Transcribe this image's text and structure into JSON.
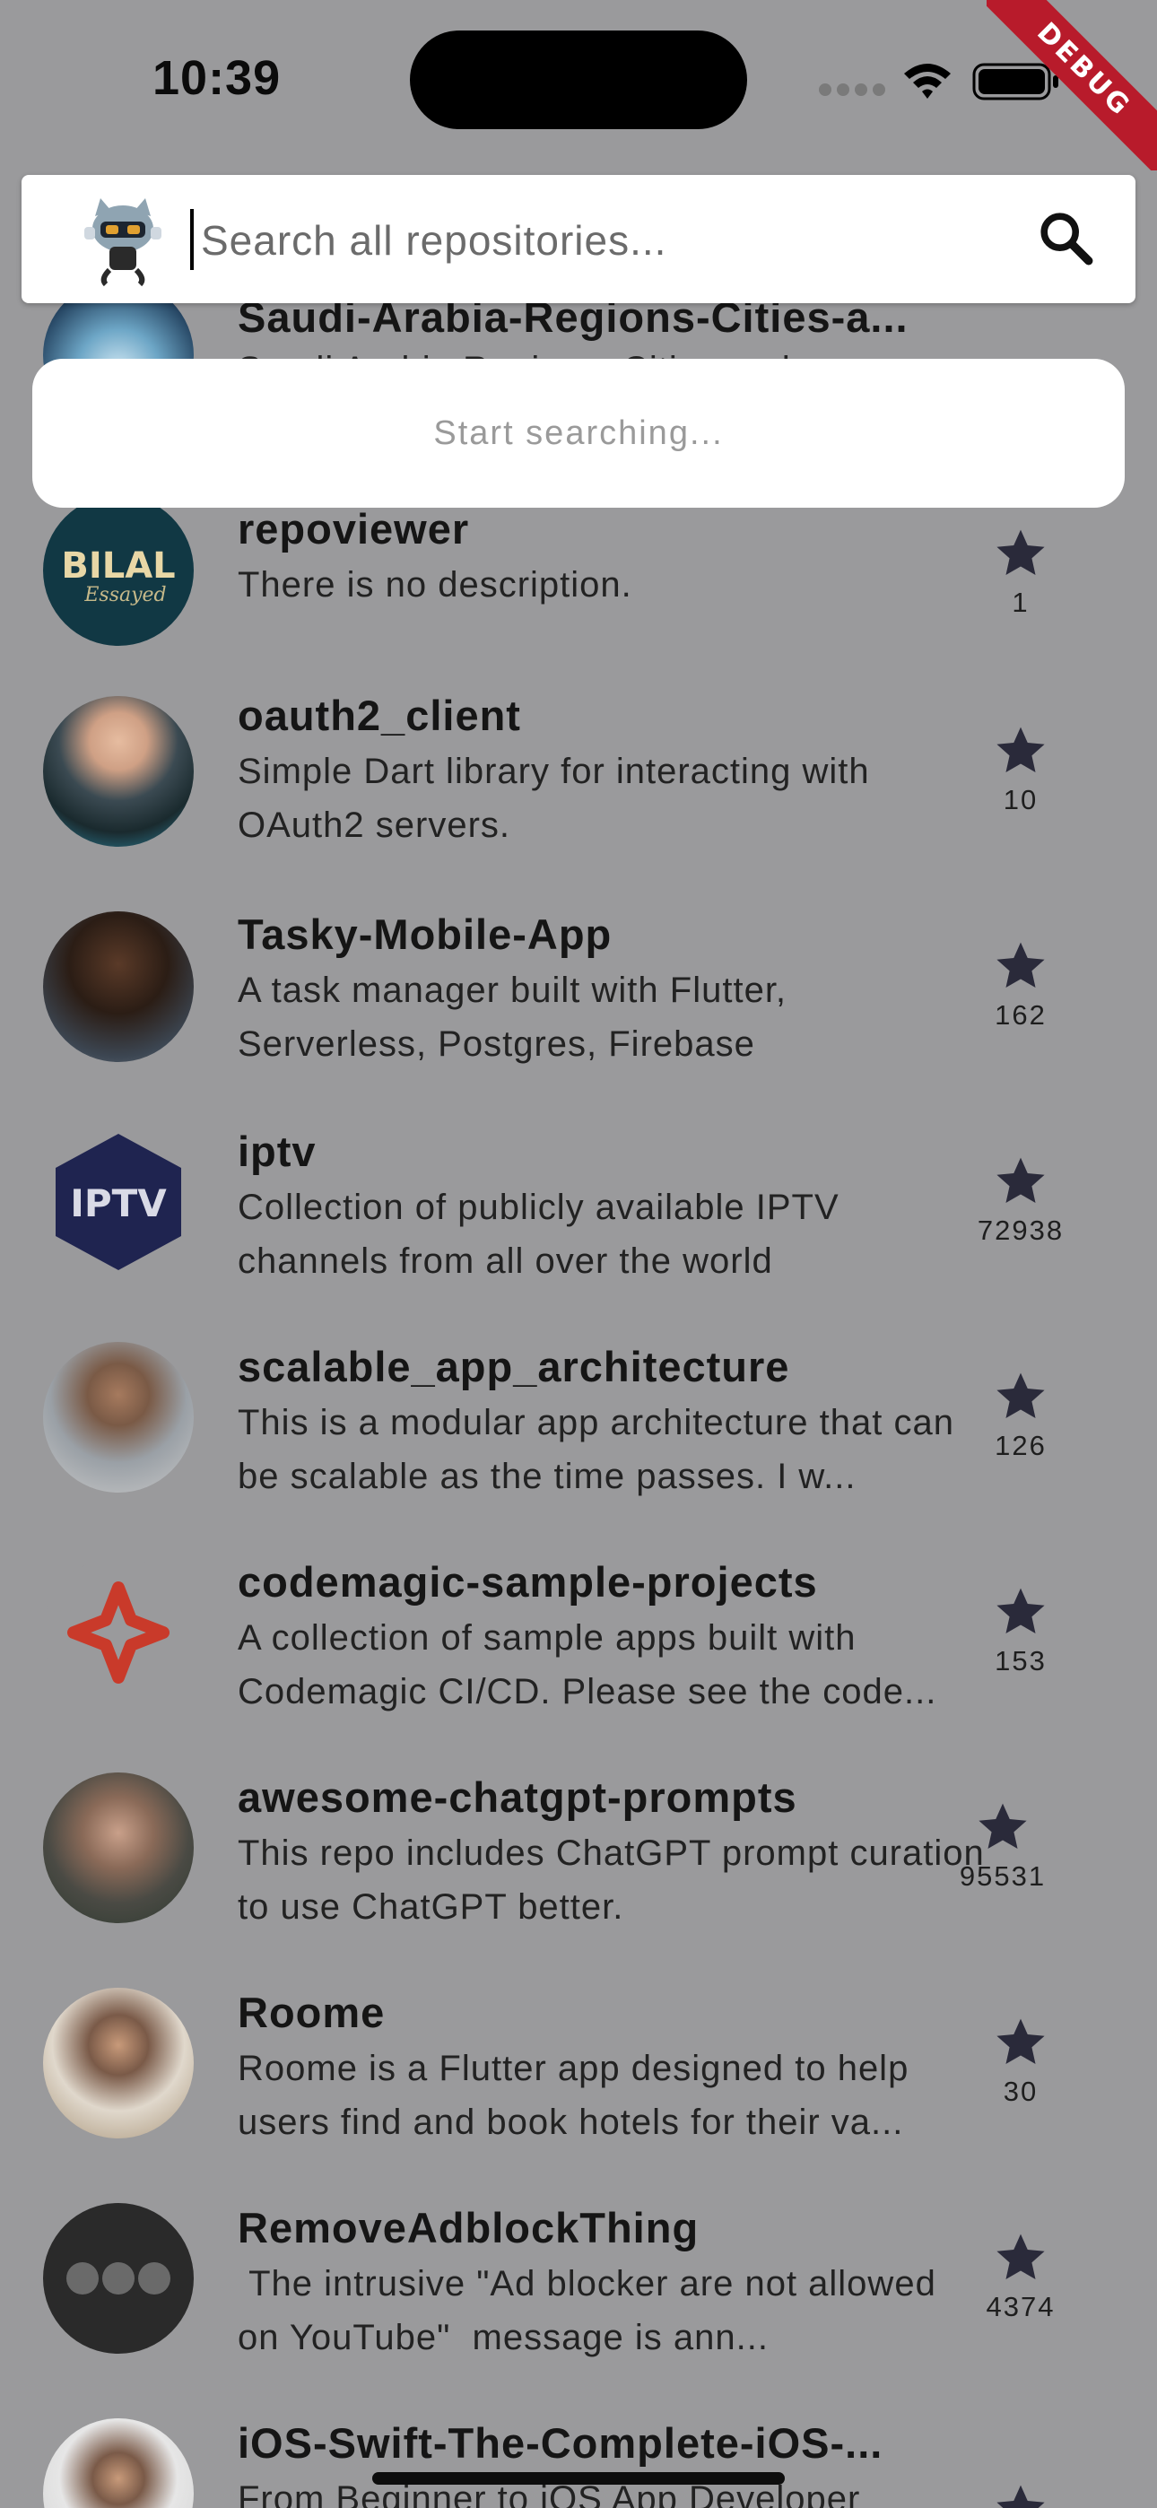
{
  "status_bar": {
    "time": "10:39"
  },
  "debug_banner": "DEBUG",
  "search": {
    "placeholder": "Search all repositories...",
    "value": ""
  },
  "suggestions": {
    "empty_text": "Start searching..."
  },
  "repositories": [
    {
      "name": "Saudi-Arabia-Regions-Cities-a...",
      "description": "Saudi Arabia Regions, Cities and...",
      "stars": ""
    },
    {
      "name": "repoviewer",
      "description": "There is no description.",
      "stars": "1"
    },
    {
      "name": "oauth2_client",
      "description": "Simple Dart library for interacting with OAuth2 servers.",
      "stars": "10"
    },
    {
      "name": "Tasky-Mobile-App",
      "description": "A task manager built with Flutter, Serverless, Postgres, Firebase",
      "stars": "162"
    },
    {
      "name": "iptv",
      "description": "Collection of publicly available IPTV channels from all over the world",
      "stars": "72938"
    },
    {
      "name": "scalable_app_architecture",
      "description": "This is a modular app architecture that can be scalable as the time passes. I w...",
      "stars": "126"
    },
    {
      "name": "codemagic-sample-projects",
      "description": "A collection of sample apps built with Codemagic CI/CD. Please see the code...",
      "stars": "153"
    },
    {
      "name": "awesome-chatgpt-prompts",
      "description": "This repo includes ChatGPT prompt curation to use ChatGPT better.",
      "stars": "95531"
    },
    {
      "name": "Roome",
      "description": "Roome is a Flutter app designed to help users find and book hotels for their va...",
      "stars": "30"
    },
    {
      "name": "RemoveAdblockThing",
      "description": " The intrusive \"Ad blocker are not allowed on YouTube\"  message is ann...",
      "stars": "4374"
    },
    {
      "name": "iOS-Swift-The-Complete-iOS-...",
      "description": "From Beginner to iOS App Developer",
      "stars": ""
    }
  ]
}
